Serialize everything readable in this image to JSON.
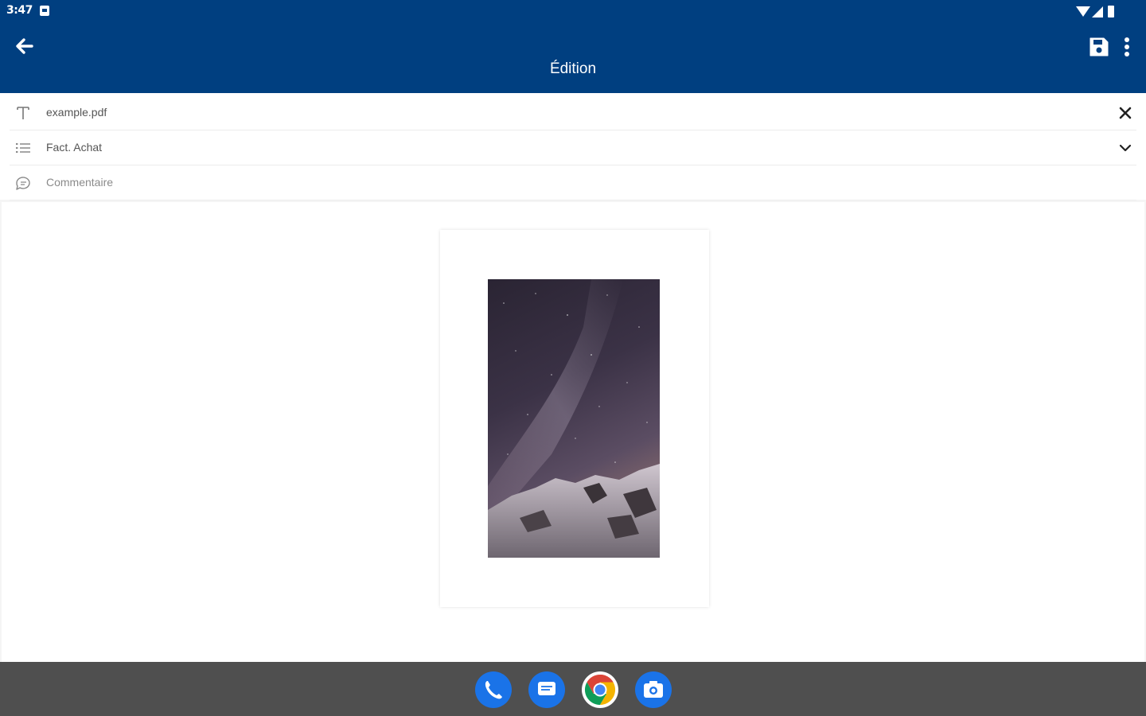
{
  "status_bar": {
    "time": "3:47"
  },
  "app_bar": {
    "title": "Édition",
    "background": "#003f80"
  },
  "form": {
    "filename": "example.pdf",
    "category": "Fact. Achat",
    "comment_placeholder": "Commentaire"
  },
  "icons": {
    "back": "arrow-back-icon",
    "save": "save-icon",
    "more": "more-vert-icon",
    "title_field": "text-format-icon",
    "category_field": "list-icon",
    "comment_field": "comment-icon",
    "clear": "close-icon",
    "expand": "chevron-down-icon"
  },
  "dock": {
    "apps": [
      "phone-app-icon",
      "messages-app-icon",
      "chrome-app-icon",
      "camera-app-icon"
    ],
    "accent": "#1a73e8"
  }
}
